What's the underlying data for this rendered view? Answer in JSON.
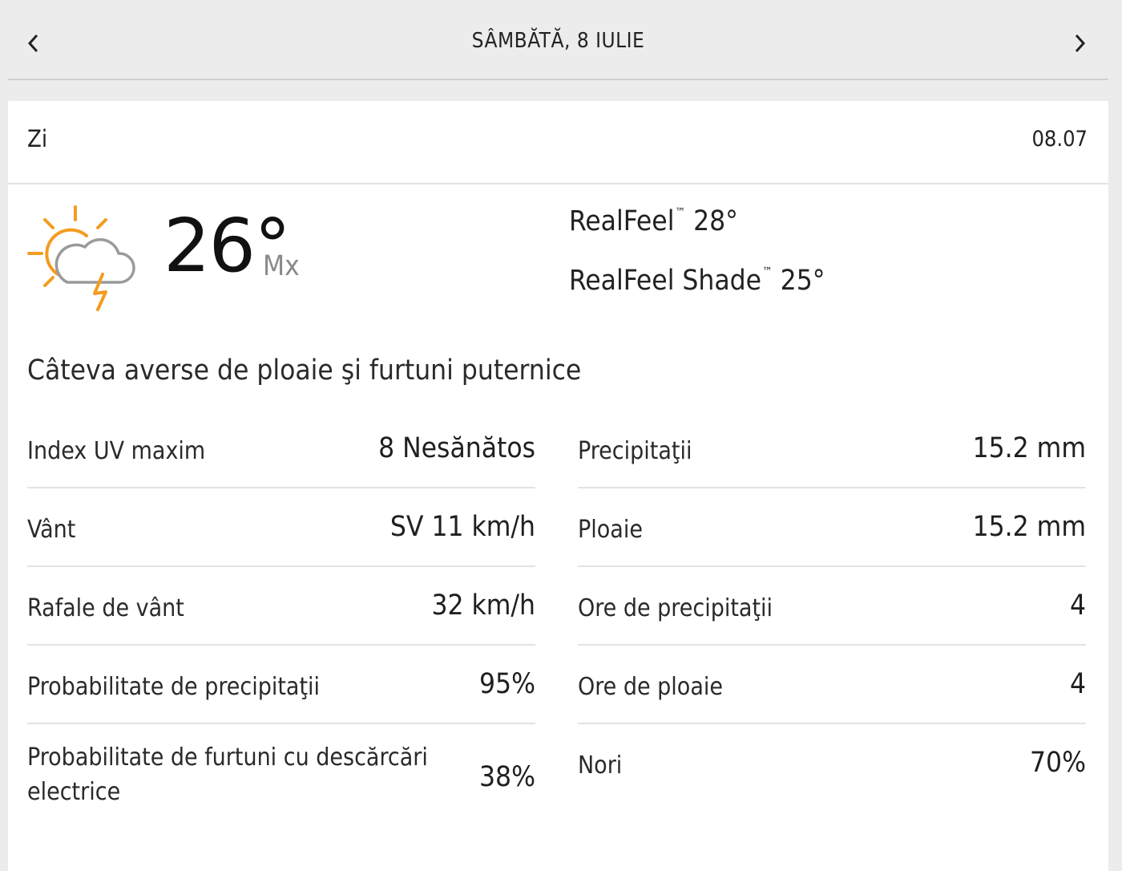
{
  "header": {
    "date_title": "SÂMBĂTĂ, 8 IULIE",
    "prev_icon": "chevron-left-icon",
    "next_icon": "chevron-right-icon"
  },
  "card": {
    "period_label": "Zi",
    "period_date": "08.07",
    "icon": "sun-cloud-thunderstorm-icon",
    "temperature": "26°",
    "temp_unit": "Mx",
    "realfeel_label": "RealFeel",
    "realfeel_value": "28°",
    "realfeel_shade_label": "RealFeel Shade",
    "realfeel_shade_value": "25°",
    "trademark": "™",
    "phrase": "Câteva averse de ploaie şi furtuni puternice"
  },
  "details_left": [
    {
      "label": "Index UV maxim",
      "value": "8 Nesănătos"
    },
    {
      "label": "Vânt",
      "value": "SV 11 km/h"
    },
    {
      "label": "Rafale de vânt",
      "value": "32 km/h"
    },
    {
      "label": "Probabilitate de precipitaţii",
      "value": "95%"
    },
    {
      "label": "Probabilitate de furtuni cu descărcări electrice",
      "value": "38%"
    }
  ],
  "details_right": [
    {
      "label": "Precipitaţii",
      "value": "15.2 mm"
    },
    {
      "label": "Ploaie",
      "value": "15.2 mm"
    },
    {
      "label": "Ore de precipitaţii",
      "value": "4"
    },
    {
      "label": "Ore de ploaie",
      "value": "4"
    },
    {
      "label": "Nori",
      "value": "70%"
    }
  ],
  "colors": {
    "sun": "#f39c1f",
    "cloud_stroke": "#9a9a9a",
    "background": "#ececec"
  }
}
